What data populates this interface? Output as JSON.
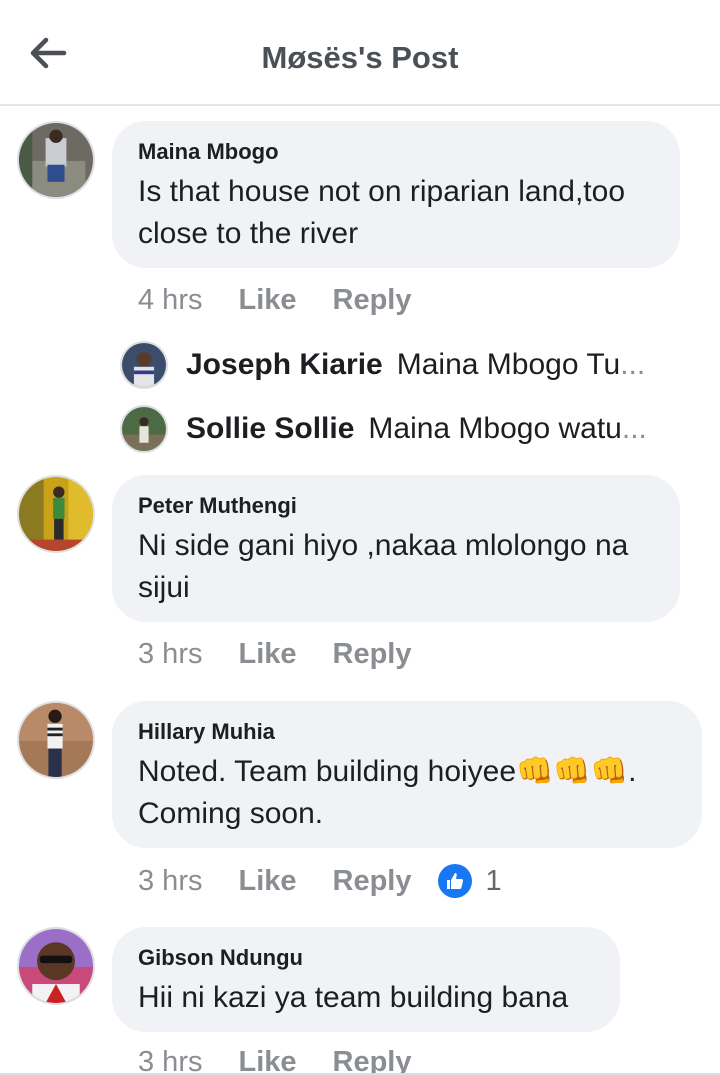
{
  "header": {
    "title": "Møsës's Post"
  },
  "comments": [
    {
      "author": "Maina Mbogo",
      "text": "Is that house not on riparian land,too close to the river",
      "time": "4 hrs",
      "like": "Like",
      "reply": "Reply"
    },
    {
      "author": "Peter Muthengi",
      "text": "Ni side gani hiyo ,nakaa mlolongo na sijui",
      "time": "3 hrs",
      "like": "Like",
      "reply": "Reply"
    },
    {
      "author": "Hillary Muhia",
      "text": "Noted. Team building hoiyee👊👊👊. Coming soon.",
      "time": "3 hrs",
      "like": "Like",
      "reply": "Reply",
      "reactions": "1"
    },
    {
      "author": "Gibson Ndungu",
      "text": "Hii ni kazi ya team building bana",
      "time": "3 hrs",
      "like": "Like",
      "reply": "Reply"
    }
  ],
  "replies": [
    {
      "author": "Joseph Kiarie",
      "preview": "Maina Mbogo Tu",
      "ellipsis": "..."
    },
    {
      "author": "Sollie Sollie",
      "preview": "Maina Mbogo watu",
      "ellipsis": "..."
    }
  ],
  "colors": {
    "accent": "#1877f2",
    "bubble": "#f0f2f5",
    "meta": "#8a8d91"
  },
  "icons": {
    "back": "arrow-left-icon",
    "like": "thumbs-up-icon"
  }
}
